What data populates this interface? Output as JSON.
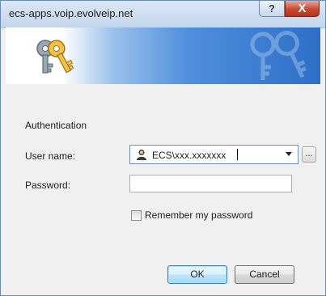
{
  "window": {
    "title": "ecs-apps.voip.evolveip.net",
    "help_glyph": "?",
    "close_glyph": "X"
  },
  "banner": {
    "icon": "keys-icon",
    "watermark_icon": "keys-watermark-icon"
  },
  "form": {
    "section_label": "Authentication",
    "user_label": "User name:",
    "user_value": "ECS\\xxx.xxxxxxx",
    "user_icon": "user-icon",
    "browse_label": "...",
    "password_label": "Password:",
    "password_value": "",
    "remember_label": "Remember my password",
    "remember_checked": false
  },
  "buttons": {
    "ok": "OK",
    "cancel": "Cancel"
  },
  "colors": {
    "banner_blue": "#2d6fc8",
    "close_red": "#c44a32",
    "focus_blue": "#3c7fb1"
  }
}
